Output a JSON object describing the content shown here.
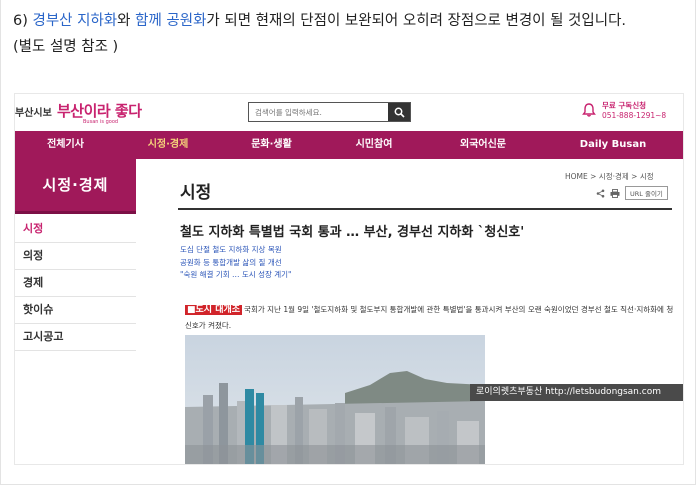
{
  "blog": {
    "number": "6) ",
    "link1": "경부산 지하화",
    "conj": "와 ",
    "link2": "함께 공원화",
    "rest": "가 되면 현재의 단점이 보완되어 오히려 장점으로 변경이 될 것입니다.",
    "note": "(별도 설명 참조 )"
  },
  "site": {
    "logo_small": "부산시보",
    "logo_main": "부산이라 좋다",
    "logo_sub": "Busan is good",
    "search_placeholder": "검색어를 입력하세요.",
    "subscribe_title": "무료 구독신청",
    "subscribe_phone": "051-888-1291~8"
  },
  "nav": [
    {
      "label": "전체기사",
      "active": false
    },
    {
      "label": "시정·경제",
      "active": true
    },
    {
      "label": "문화·생활",
      "active": false
    },
    {
      "label": "시민참여",
      "active": false
    },
    {
      "label": "외국어신문",
      "active": false
    },
    {
      "label": "Daily Busan",
      "active": false
    }
  ],
  "sidebar": {
    "heading": "시정·경제",
    "items": [
      {
        "label": "시정",
        "active": true
      },
      {
        "label": "의정",
        "active": false
      },
      {
        "label": "경제",
        "active": false
      },
      {
        "label": "핫이슈",
        "active": false
      },
      {
        "label": "고시공고",
        "active": false
      }
    ]
  },
  "content": {
    "breadcrumb": "HOME > 시정·경제 > 시정",
    "url_copy": "URL 줄이기",
    "page_title": "시정",
    "article_title": "철도 지하화 특별법 국회 통과 … 부산, 경부선 지하화 `청신호'",
    "subheads": [
      "도심 단절 철도 지하화 지상 복원",
      "공원화 등 통합개발 삶의 질 개선",
      "\"숙원 해결 기회 … 도시 성장 계기\""
    ],
    "lead_tag": "■도시 대개조",
    "lead_text": "국회가 지난 1월 9일 '철도지하화 및 철도부지 통합개발에 관한 특별법'을 통과시켜 부산의 오랜 숙원이었던 경부선 철도 직선·지하화에 청신호가 켜졌다.",
    "watermark": "로이의렛츠부동산 http://letsbudongsan.com"
  },
  "colors": {
    "brand": "#a0195a",
    "link": "#2b66c9",
    "nav_active": "#f5d37a",
    "tag_red": "#d1242a"
  }
}
